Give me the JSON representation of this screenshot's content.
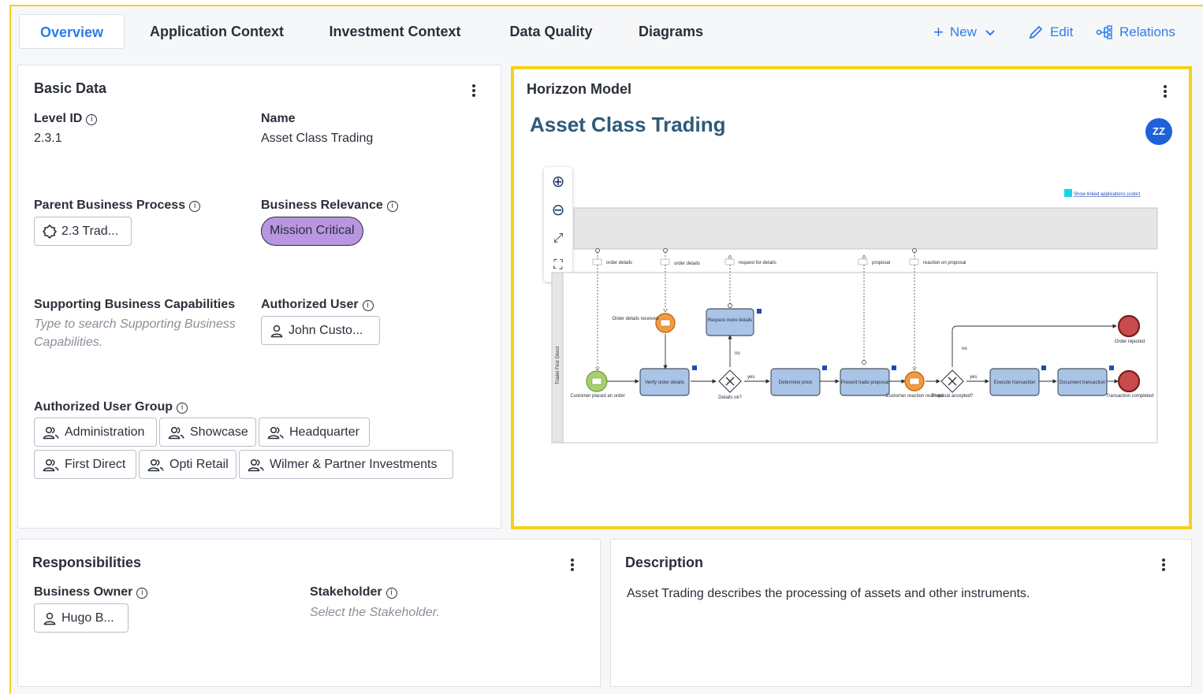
{
  "tabs": [
    {
      "label": "Overview"
    },
    {
      "label": "Application Context"
    },
    {
      "label": "Investment Context"
    },
    {
      "label": "Data Quality"
    },
    {
      "label": "Diagrams"
    }
  ],
  "actions": {
    "new": "New",
    "edit": "Edit",
    "relations": "Relations"
  },
  "basic_data": {
    "title": "Basic Data",
    "level_id_label": "Level ID",
    "level_id_value": "2.3.1",
    "name_label": "Name",
    "name_value": "Asset Class Trading",
    "parent_label": "Parent Business Process",
    "parent_value": "2.3 Trad...",
    "relevance_label": "Business Relevance",
    "relevance_value": "Mission Critical",
    "capabilities_label": "Supporting Business Capabilities",
    "capabilities_placeholder": "Type to search Supporting Business Capabilities.",
    "auth_user_label": "Authorized User",
    "auth_user_value": "John Custo...",
    "auth_group_label": "Authorized User Group",
    "groups": [
      "Administration",
      "Showcase",
      "Headquarter",
      "First Direct",
      "Opti Retail",
      "Wilmer & Partner Investments"
    ]
  },
  "horizzon": {
    "title": "Horizzon Model",
    "heading": "Asset Class Trading",
    "avatar": "ZZ",
    "diagram": {
      "link": "Show linked applications (color)",
      "lane": "Trader First Direct",
      "messages": [
        "order details",
        "order details",
        "request for details",
        "proposal",
        "reaction on proposal"
      ],
      "tasks": [
        "Request more details",
        "Verify order details",
        "Determine price",
        "Present trade proposal",
        "Execute transaction",
        "Document transaction"
      ],
      "events": [
        "Order details received",
        "Customer placed an order",
        "Customer reaction received",
        "Order rejected",
        "Transaction completed"
      ],
      "gateways": [
        "Details ok?",
        "Proposal accepted?"
      ],
      "flow_labels": [
        "no",
        "yes",
        "no",
        "yes"
      ]
    }
  },
  "responsibilities": {
    "title": "Responsibilities",
    "owner_label": "Business Owner",
    "owner_value": "Hugo B...",
    "stakeholder_label": "Stakeholder",
    "stakeholder_placeholder": "Select the Stakeholder."
  },
  "description": {
    "title": "Description",
    "text": "Asset Trading describes the processing of assets and other instruments."
  },
  "colors": {
    "accent": "#2b7de9",
    "highlight": "#f5d21a",
    "relevance_badge": "#b996e0",
    "task_fill": "#a9c4e6",
    "avatar": "#1f62d8"
  }
}
